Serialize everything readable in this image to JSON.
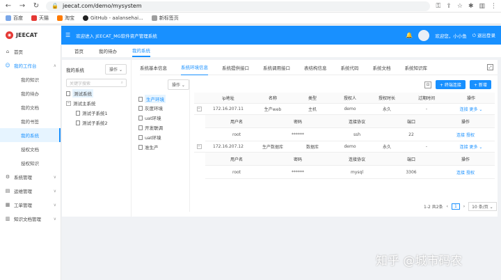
{
  "browser": {
    "url": "jeecat.com/demo/mysystem",
    "bookmarks": [
      "百度",
      "天猫",
      "淘宝",
      "GitHub - aalansehai...",
      "新标签页"
    ]
  },
  "header": {
    "app_name": "JEECAT",
    "welcome": "欢迎进入 JEECAT_MG软件资产管理系统",
    "user": "欢迎您，小小鱼",
    "logout": "退出登录"
  },
  "sidebar": {
    "home": "首页",
    "workbench": "我的工作台",
    "sub_items": [
      "我的知识",
      "我的待办",
      "我的文档",
      "我的书签",
      "我的系统",
      "授权文档",
      "授权知识"
    ],
    "active_sub": 4,
    "groups": [
      "系统管理",
      "运维管理",
      "工单管理",
      "知识文档管理"
    ]
  },
  "page_tabs": [
    "首页",
    "我的待办",
    "我的系统"
  ],
  "active_page_tab": 2,
  "tree": {
    "title": "我的系统",
    "op_label": "操作",
    "search_placeholder": "关键字搜索",
    "nodes": [
      "测试系统",
      "测试主系统",
      "测试子系统1",
      "测试子系统2"
    ]
  },
  "sys_tabs": [
    "系统基本信息",
    "系统环境信息",
    "系统提供接口",
    "系统调用接口",
    "表结构信息",
    "系统代码",
    "系统文档",
    "系统知识库"
  ],
  "active_sys_tab": 1,
  "envs": {
    "op_label": "操作",
    "items": [
      "生产环境",
      "灰度环境",
      "uat环境",
      "开发联调",
      "uat环境",
      "准生产"
    ]
  },
  "toolbar": {
    "add_conn": "+ 终端连接",
    "add_new": "+ 新增"
  },
  "table": {
    "headers": [
      "ip地址",
      "名称",
      "类型",
      "授权人",
      "授权时长",
      "过期时间",
      "操作"
    ],
    "sub_headers": [
      "用户名",
      "密码",
      "连接协议",
      "端口",
      "操作"
    ],
    "rows": [
      {
        "ip": "172.16.207.11",
        "name": "生产web",
        "type": "主机",
        "auth": "demo",
        "len": "永久",
        "exp": "-",
        "ops": [
          "连接",
          "更多 ⌄"
        ],
        "sub": {
          "user": "root",
          "pwd": "******",
          "proto": "ssh",
          "port": "22",
          "ops": [
            "连接",
            "授权"
          ]
        }
      },
      {
        "ip": "172.16.207.12",
        "name": "生产数据库",
        "type": "数据库",
        "auth": "demo",
        "len": "永久",
        "exp": "-",
        "ops": [
          "连接",
          "更多 ⌄"
        ],
        "sub": {
          "user": "root",
          "pwd": "******",
          "proto": "mysql",
          "port": "3306",
          "ops": [
            "连接",
            "授权"
          ]
        }
      }
    ]
  },
  "pager": {
    "summary": "1-2 共2条",
    "page": "1",
    "size": "10 条/页"
  },
  "watermark": "知乎 @城市码农"
}
